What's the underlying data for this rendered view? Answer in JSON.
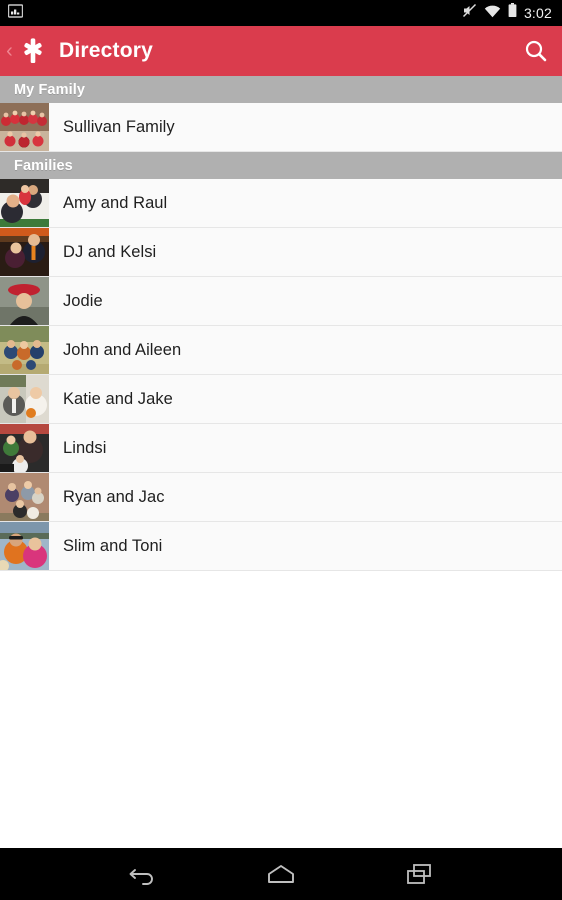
{
  "status_bar": {
    "notification_icon": "image-notification-icon",
    "silent_icon": "volume-muted-icon",
    "wifi_icon": "wifi-icon",
    "battery_icon": "battery-full-icon",
    "clock": "3:02",
    "background_color": "#000000",
    "text_color": "#f2f2f2"
  },
  "app_bar": {
    "back_icon": "chevron-left-icon",
    "logo_icon": "star-burst-logo-icon",
    "title": "Directory",
    "search_icon": "search-icon",
    "background_color": "#da3c4d",
    "title_color": "#ffffff"
  },
  "list": {
    "background_color": "#fafafa",
    "divider_color": "#e6e6e6",
    "header_background_color": "#b0b0b0",
    "header_text_color": "#ffffff",
    "item_text_color": "#1f1f1f",
    "sections": [
      {
        "header": "My Family",
        "items": [
          {
            "label": "Sullivan Family",
            "thumbnail": "family-group-photo-red-shirts"
          }
        ]
      },
      {
        "header": "Families",
        "items": [
          {
            "label": "Amy and Raul",
            "thumbnail": "couple-with-child-photo"
          },
          {
            "label": "DJ and Kelsi",
            "thumbnail": "couple-formal-orange-tie-photo"
          },
          {
            "label": "Jodie",
            "thumbnail": "person-graduation-red-hat-photo"
          },
          {
            "label": "John and Aileen",
            "thumbnail": "family-outdoor-field-photo"
          },
          {
            "label": "Katie and Jake",
            "thumbnail": "wedding-couple-photo"
          },
          {
            "label": "Lindsi",
            "thumbnail": "mother-with-children-photo"
          },
          {
            "label": "Ryan and Jac",
            "thumbnail": "family-brick-wall-photo"
          },
          {
            "label": "Slim and Toni",
            "thumbnail": "couple-sunglasses-outdoor-photo"
          }
        ]
      }
    ]
  },
  "nav_bar": {
    "background_color": "#000000",
    "buttons": [
      {
        "name": "back",
        "icon": "back-arrow-icon"
      },
      {
        "name": "home",
        "icon": "home-icon"
      },
      {
        "name": "recents",
        "icon": "recent-apps-icon"
      }
    ]
  }
}
